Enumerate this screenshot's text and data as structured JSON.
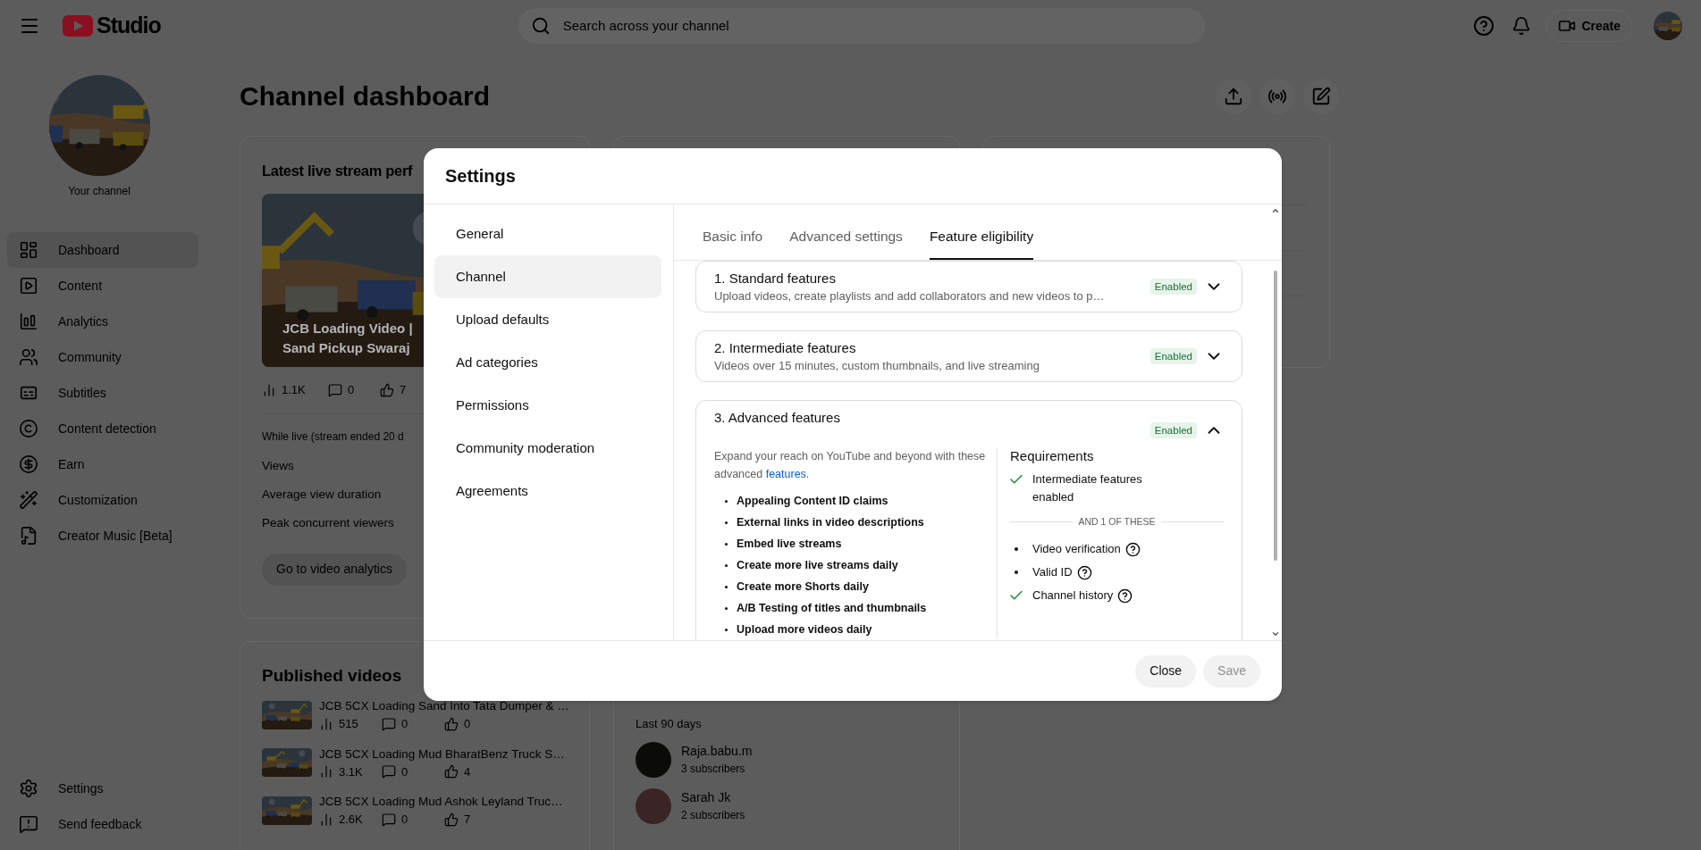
{
  "header": {
    "logo_text": "Studio",
    "search_placeholder": "Search across your channel",
    "create_label": "Create"
  },
  "sidebar": {
    "channel_label": "Your channel",
    "items": [
      {
        "label": "Dashboard",
        "selected": true
      },
      {
        "label": "Content",
        "selected": false
      },
      {
        "label": "Analytics",
        "selected": false
      },
      {
        "label": "Community",
        "selected": false
      },
      {
        "label": "Subtitles",
        "selected": false
      },
      {
        "label": "Content detection",
        "selected": false
      },
      {
        "label": "Earn",
        "selected": false
      },
      {
        "label": "Customization",
        "selected": false
      },
      {
        "label": "Creator Music [Beta]",
        "selected": false
      }
    ],
    "footer_items": [
      {
        "label": "Settings"
      },
      {
        "label": "Send feedback"
      }
    ]
  },
  "dashboard": {
    "title": "Channel dashboard",
    "live_card": {
      "title": "Latest live stream perf",
      "video_title_lines": [
        "JCB Loading Video |",
        "Sand Pickup Swaraj"
      ],
      "views": "1.1K",
      "comments": "0",
      "likes": "7",
      "note": "While live (stream ended 20 d",
      "metrics": [
        "Views",
        "Average view duration",
        "Peak concurrent viewers"
      ],
      "button": "Go to video analytics"
    },
    "published_videos": {
      "title": "Published videos",
      "videos": [
        {
          "title": "JCB 5CX Loading Sand Into Tata Dumper & …",
          "views": "515",
          "comments": "0",
          "likes": "0"
        },
        {
          "title": "JCB 5CX Loading Mud BharatBenz Truck S…",
          "views": "3.1K",
          "comments": "0",
          "likes": "4"
        },
        {
          "title": "JCB 5CX Loading Mud Ashok Leyland Truc…",
          "views": "2.6K",
          "comments": "0",
          "likes": "7"
        }
      ]
    },
    "recent_subscribers": {
      "subtitle": "Last 90 days",
      "subscribers": [
        {
          "name": "Raja.babu.m",
          "count": "3 subscribers"
        },
        {
          "name": "Sarah Jk",
          "count": "2 subscribers"
        }
      ]
    }
  },
  "settings_dialog": {
    "title": "Settings",
    "nav": [
      {
        "label": "General",
        "selected": false
      },
      {
        "label": "Channel",
        "selected": true
      },
      {
        "label": "Upload defaults",
        "selected": false
      },
      {
        "label": "Ad categories",
        "selected": false
      },
      {
        "label": "Permissions",
        "selected": false
      },
      {
        "label": "Community moderation",
        "selected": false
      },
      {
        "label": "Agreements",
        "selected": false
      }
    ],
    "tabs": [
      {
        "label": "Basic info",
        "selected": false
      },
      {
        "label": "Advanced settings",
        "selected": false
      },
      {
        "label": "Feature eligibility",
        "selected": true
      }
    ],
    "features": [
      {
        "title": "1. Standard features",
        "description": "Upload videos, create playlists and add collaborators and new videos to p…",
        "status": "Enabled",
        "expanded": false
      },
      {
        "title": "2. Intermediate features",
        "description": "Videos over 15 minutes, custom thumbnails, and live streaming",
        "status": "Enabled",
        "expanded": false
      },
      {
        "title": "3. Advanced features",
        "status": "Enabled",
        "expanded": true,
        "intro": "Expand your reach on YouTube and beyond with these advanced ",
        "intro_link": "features",
        "intro_end": ".",
        "perks": [
          "Appealing Content ID claims",
          "External links in video descriptions",
          "Embed live streams",
          "Create more live streams daily",
          "Create more Shorts daily",
          "A/B Testing of titles and thumbnails",
          "Upload more videos daily"
        ],
        "requirements": {
          "title": "Requirements",
          "items": [
            {
              "label": "Intermediate features enabled",
              "met": true,
              "help": false
            }
          ],
          "divider": "AND 1 OF THESE",
          "options": [
            {
              "label": "Video verification",
              "met": false,
              "help": true
            },
            {
              "label": "Valid ID",
              "met": false,
              "help": true
            },
            {
              "label": "Channel history",
              "met": true,
              "help": true
            }
          ]
        }
      }
    ],
    "buttons": [
      {
        "label": "Close",
        "disabled": false
      },
      {
        "label": "Save",
        "disabled": true
      }
    ]
  }
}
